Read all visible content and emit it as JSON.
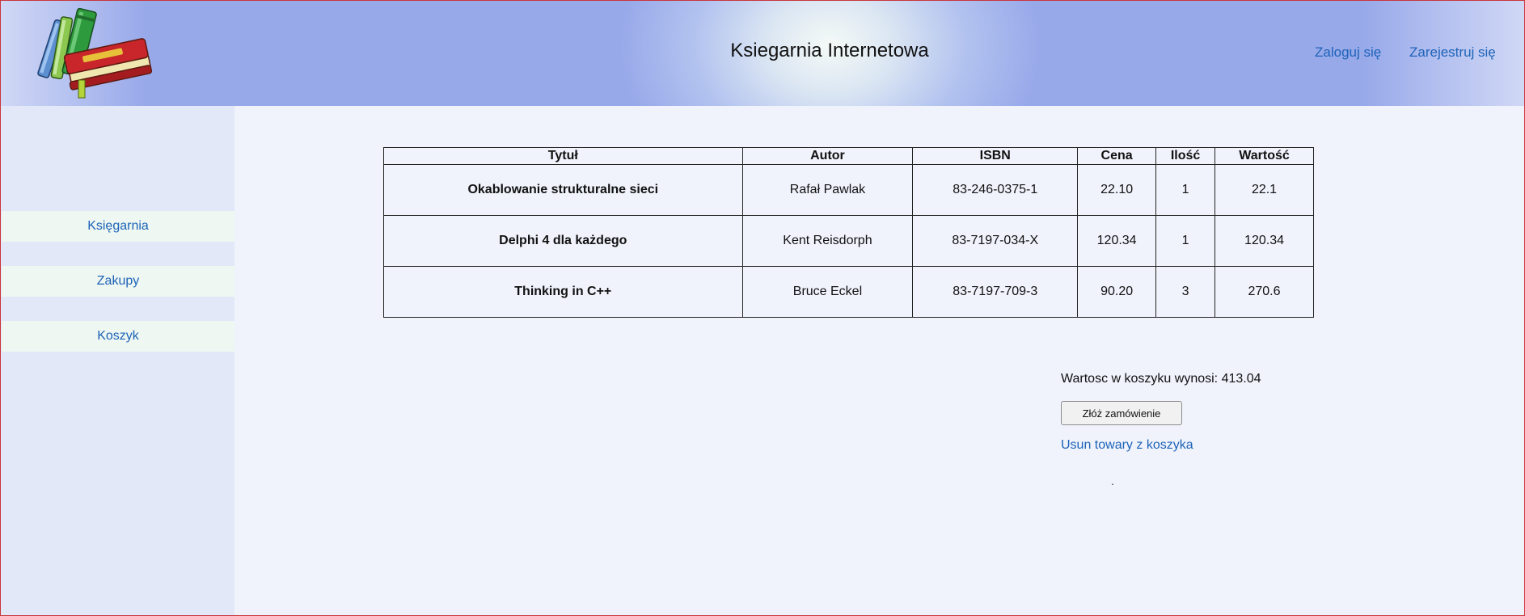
{
  "header": {
    "title": "Ksiegarnia Internetowa",
    "login_label": "Zaloguj się",
    "register_label": "Zarejestruj się"
  },
  "sidebar": {
    "items": [
      {
        "label": "Księgarnia"
      },
      {
        "label": "Zakupy"
      },
      {
        "label": "Koszyk"
      }
    ]
  },
  "cart": {
    "columns": [
      "Tytuł",
      "Autor",
      "ISBN",
      "Cena",
      "Ilość",
      "Wartość"
    ],
    "rows": [
      {
        "title": "Okablowanie strukturalne sieci",
        "author": "Rafał Pawlak",
        "isbn": "83-246-0375-1",
        "price": "22.10",
        "qty": "1",
        "value": "22.1"
      },
      {
        "title": "Delphi 4 dla każdego",
        "author": "Kent Reisdorph",
        "isbn": "83-7197-034-X",
        "price": "120.34",
        "qty": "1",
        "value": "120.34"
      },
      {
        "title": "Thinking in C++",
        "author": "Bruce Eckel",
        "isbn": "83-7197-709-3",
        "price": "90.20",
        "qty": "3",
        "value": "270.6"
      }
    ],
    "summary": "Wartosc w koszyku wynosi: 413.04",
    "order_button": "Złóż zamówienie",
    "remove_link": "Usun towary z koszyka",
    "footer_dot": "."
  },
  "colors": {
    "link": "#1d63b8",
    "frame_border": "#c9353a",
    "header_blue": "#98a9ea"
  },
  "icons": {
    "logo": "books-logo-icon"
  }
}
